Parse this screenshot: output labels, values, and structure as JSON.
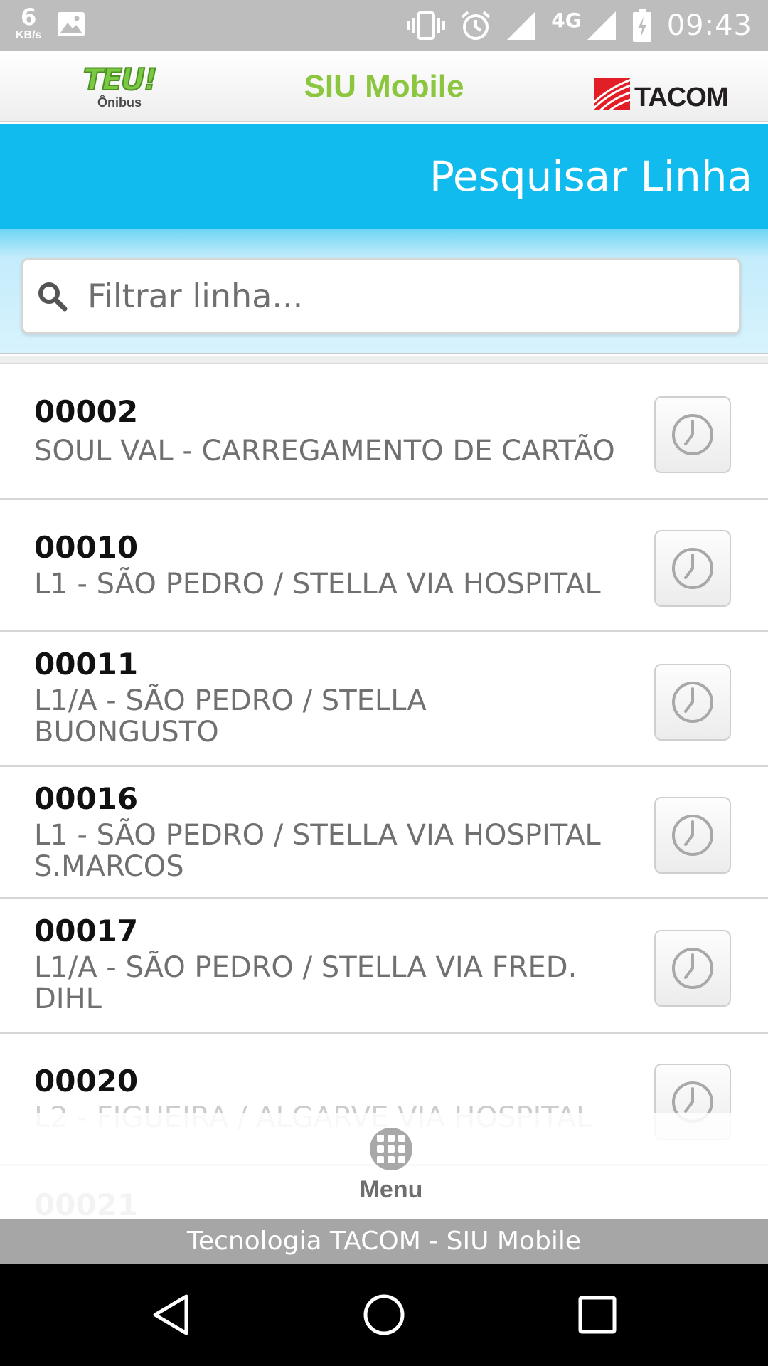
{
  "status_bar": {
    "speed_value": "6",
    "speed_unit": "KB/s",
    "network": "4G",
    "time": "09:43"
  },
  "app_header": {
    "left_logo_text": "TEU!",
    "left_logo_sub": "Ônibus",
    "title": "SIU Mobile",
    "right_logo_text": "TACOM"
  },
  "page": {
    "title": "Pesquisar Linha"
  },
  "search": {
    "placeholder": "Filtrar linha...",
    "value": ""
  },
  "lines": [
    {
      "code": "00002",
      "name": "SOUL VAL - CARREGAMENTO DE CARTÃO"
    },
    {
      "code": "00010",
      "name": "L1 - SÃO PEDRO / STELLA VIA HOSPITAL"
    },
    {
      "code": "00011",
      "name": "L1/A - SÃO PEDRO / STELLA BUONGUSTO"
    },
    {
      "code": "00016",
      "name": "L1 - SÃO PEDRO / STELLA VIA HOSPITAL S.MARCOS"
    },
    {
      "code": "00017",
      "name": "L1/A - SÃO PEDRO / STELLA VIA FRED. DIHL"
    },
    {
      "code": "00020",
      "name": "L2 - FIGUEIRA / ALGARVE VIA HOSPITAL"
    },
    {
      "code": "00021",
      "name": ""
    }
  ],
  "menu": {
    "label": "Menu"
  },
  "footer": {
    "text": "Tecnologia TACOM - SIU Mobile"
  },
  "colors": {
    "accent_blue": "#12bbed",
    "title_green": "#8cc63f",
    "status_bar_gray": "#bdbdbd",
    "footer_gray": "#a6a6a6"
  }
}
